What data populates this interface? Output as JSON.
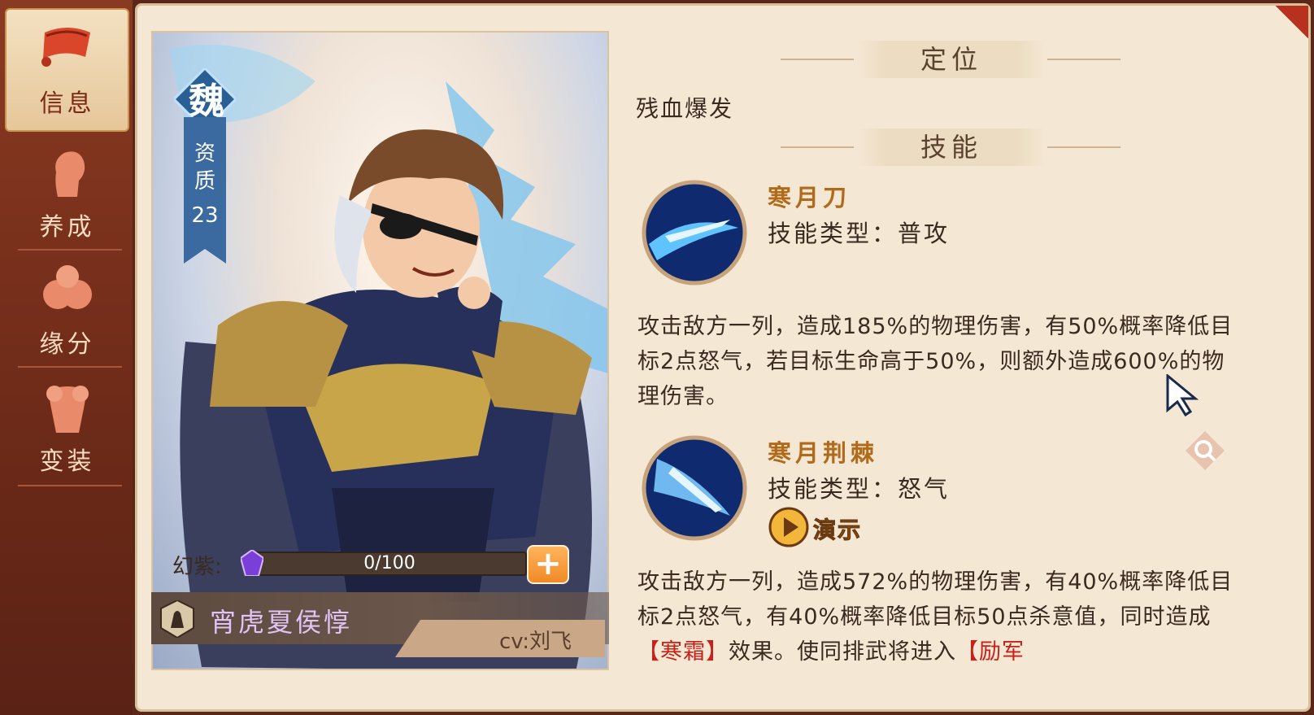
{
  "sidebar": {
    "items": [
      {
        "label": "信息",
        "icon": "scroll-icon",
        "active": true
      },
      {
        "label": "养成",
        "icon": "head-silhouette-icon",
        "active": false
      },
      {
        "label": "缘分",
        "icon": "fists-icon",
        "active": false
      },
      {
        "label": "变装",
        "icon": "armor-icon",
        "active": false
      }
    ]
  },
  "hero": {
    "faction": "魏",
    "aptitude_label": "资\n质",
    "aptitude_value": "23",
    "huanzi_label": "幻紫:",
    "huanzi_progress": "0/100",
    "huanzi_fraction": 0,
    "name": "宵虎夏侯惇",
    "cv": "cv:刘飞"
  },
  "info": {
    "role_heading": "定位",
    "role": "残血爆发",
    "skills_heading": "技能",
    "skills": [
      {
        "name": "寒月刀",
        "type": "技能类型：普攻",
        "desc": "攻击敌方一列，造成185%的物理伤害，有50%概率降低目标2点怒气，若目标生命高于50%，则额外造成600%的物理伤害。"
      },
      {
        "name": "寒月荆棘",
        "type": "技能类型：怒气",
        "demo_label": "演示",
        "desc_a": "攻击敌方一列，造成572%的物理伤害，有40%概率降低目标2点怒气，有40%概率降低目标50点杀意值，同时造成",
        "desc_hl1": "【寒霜】",
        "desc_b": "效果。使同排武将进入",
        "desc_hl2": "【励军"
      }
    ]
  },
  "colors": {
    "accent_red": "#c8201a",
    "skill_name": "#b06a1a",
    "parchment": "#f4e7d3",
    "sidebar": "#8a3a22"
  }
}
